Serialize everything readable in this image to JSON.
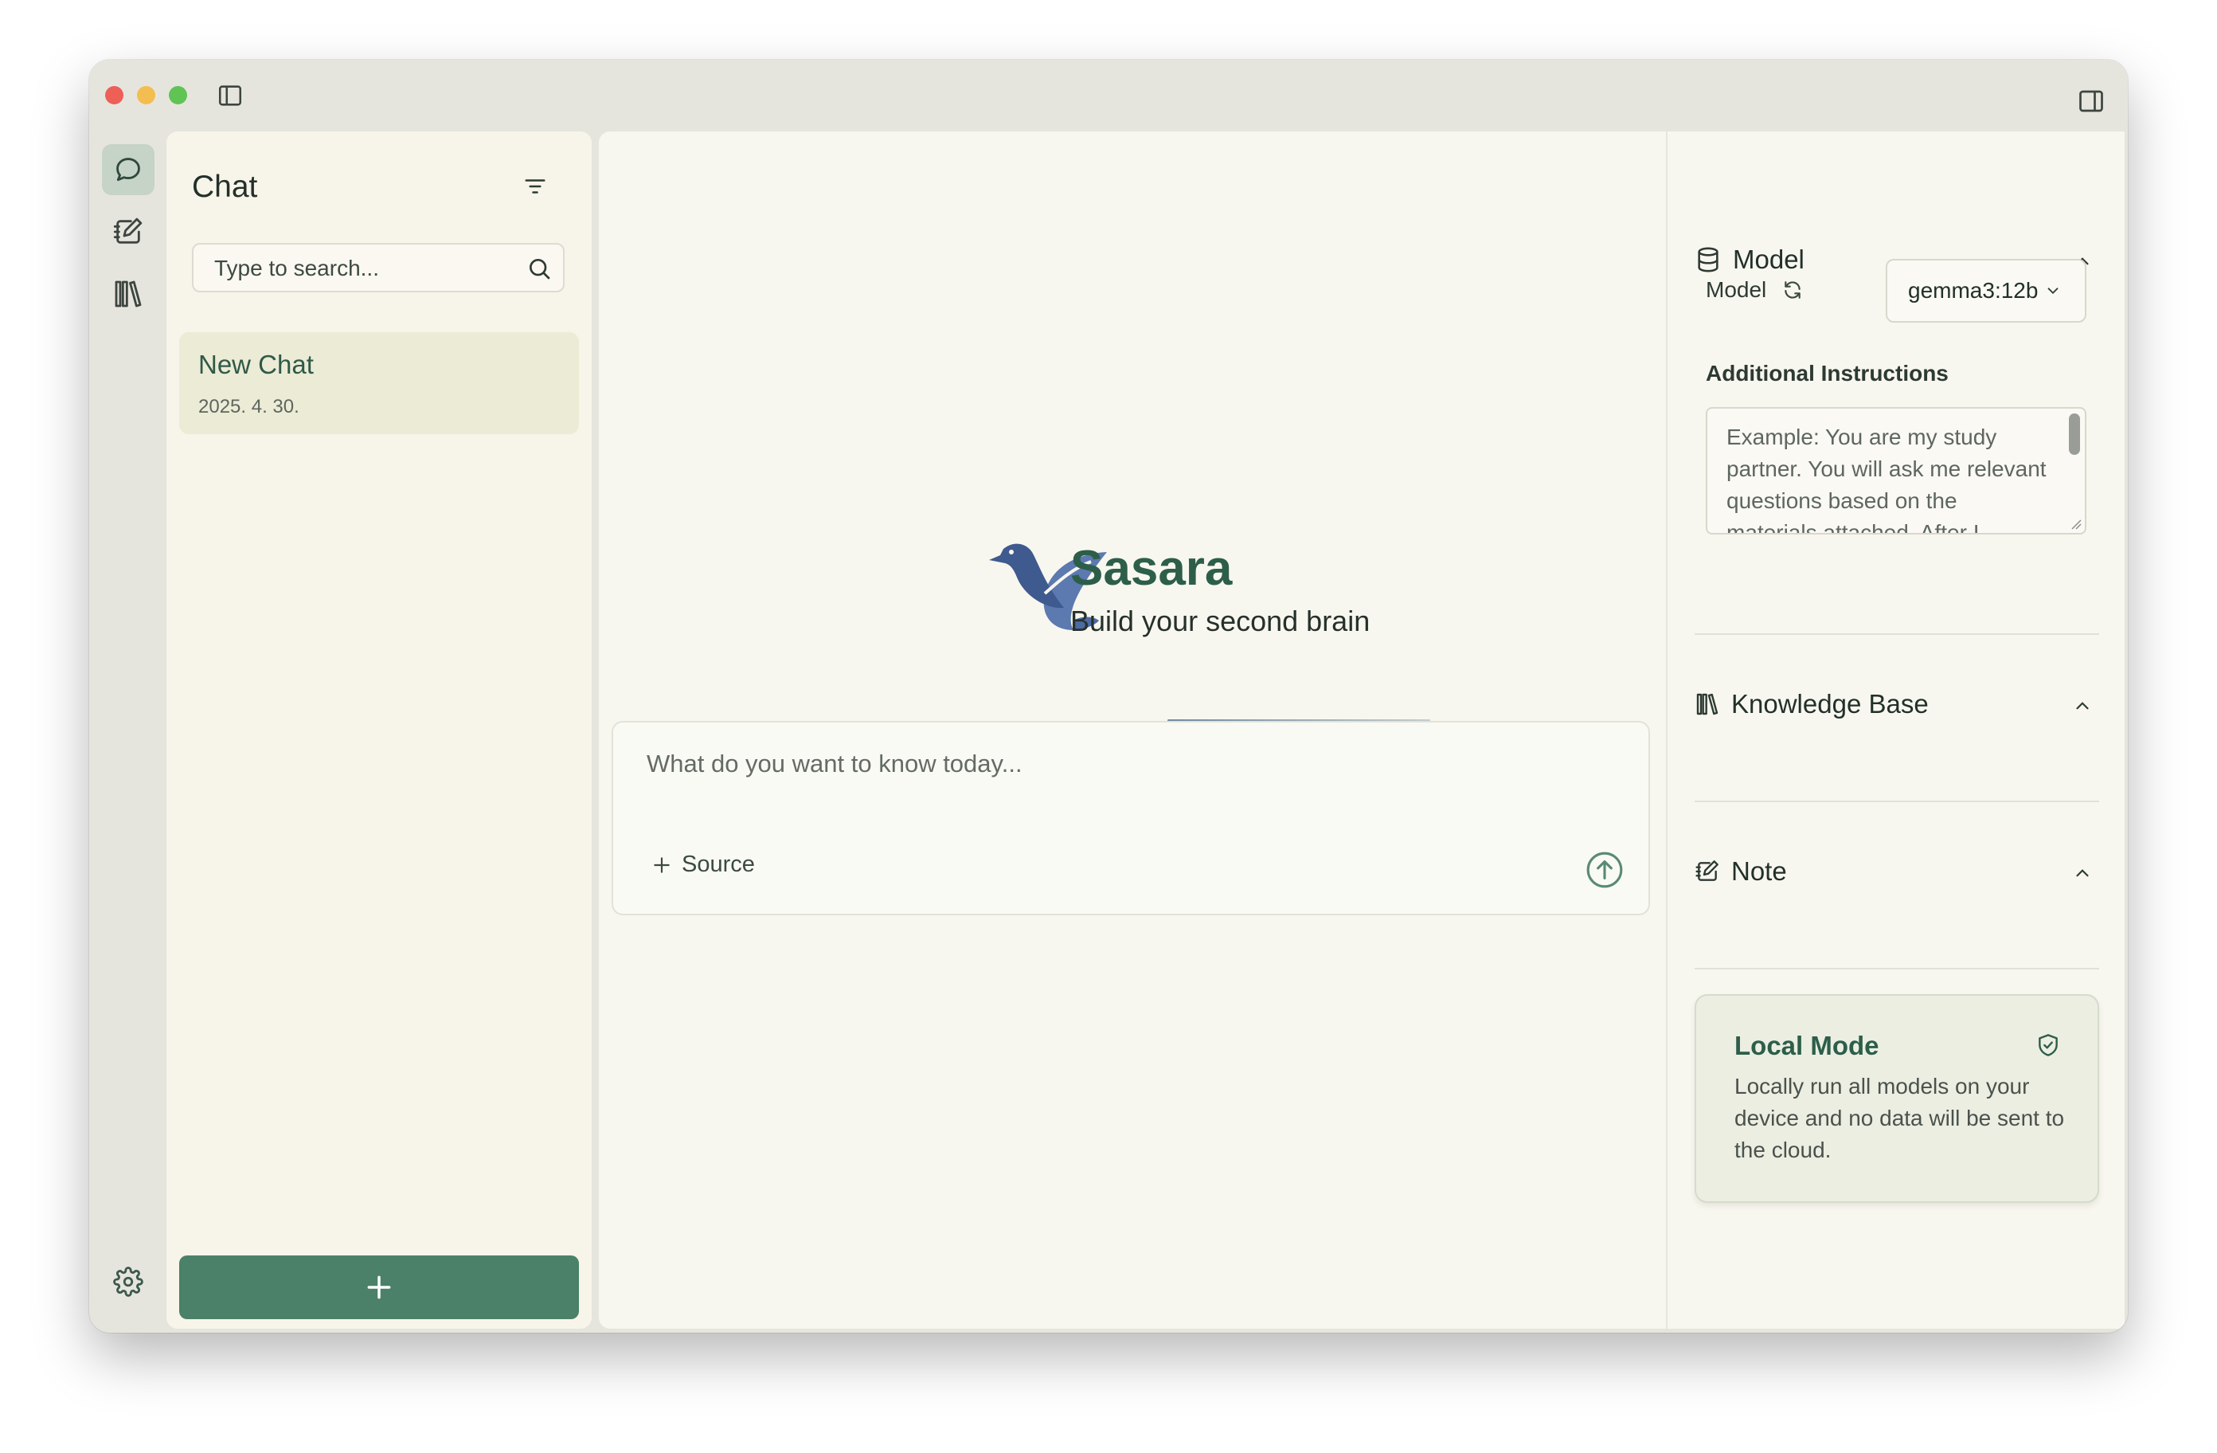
{
  "window": {
    "icons": [
      "sidebar-toggle-icon",
      "right-panel-toggle-icon"
    ]
  },
  "rail": {
    "items": [
      {
        "name": "chat",
        "icon": "chat-bubble-icon",
        "active": true
      },
      {
        "name": "notes",
        "icon": "note-edit-icon",
        "active": false
      },
      {
        "name": "library",
        "icon": "library-books-icon",
        "active": false
      }
    ],
    "settings_icon": "gear-icon"
  },
  "chat_panel": {
    "title": "Chat",
    "search_placeholder": "Type to search...",
    "items": [
      {
        "title": "New Chat",
        "date": "2025. 4. 30."
      }
    ],
    "new_chat_icon": "plus-icon"
  },
  "main": {
    "brand_name": "Sasara",
    "tagline": "Build your second brain",
    "composer_placeholder": "What do you want to know today...",
    "source_label": "Source"
  },
  "right_panel": {
    "model_section": {
      "title": "Model",
      "model_label": "Model",
      "selected_model": "gemma3:12b",
      "additional_instructions_label": "Additional Instructions",
      "instructions_placeholder": "Example: You are my study partner. You will ask me relevant questions based on the materials attached. After I"
    },
    "knowledge_base_section": {
      "title": "Knowledge Base"
    },
    "note_section": {
      "title": "Note"
    },
    "local_mode": {
      "title": "Local Mode",
      "description": "Locally run all models on your device and no data will be sent to the cloud."
    }
  },
  "colors": {
    "accent": "#4a8168",
    "brand_text": "#2d5e4a",
    "window_bg": "#e6e5dd",
    "panel_bg": "#f8f7ef",
    "selected_item_bg": "#ecebd5"
  }
}
